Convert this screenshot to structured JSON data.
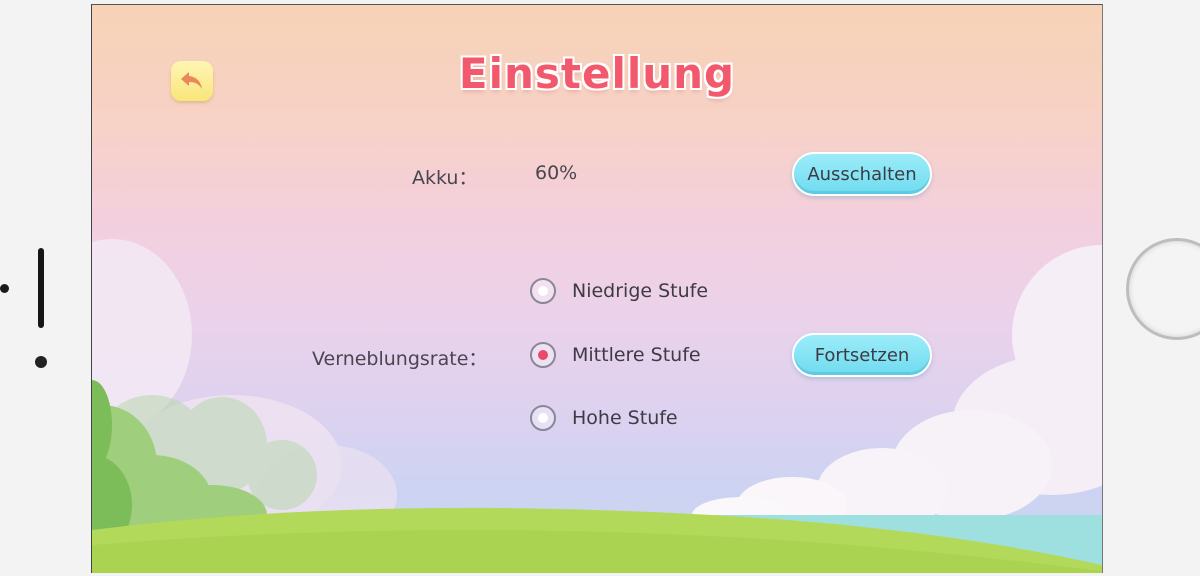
{
  "screen": {
    "title": "Einstellung",
    "back_icon": "back-arrow-icon"
  },
  "battery": {
    "label": "Akku：",
    "value": "60%",
    "shutdown_label": "Ausschalten"
  },
  "glare": {
    "label": "Verneblungsrate：",
    "options": [
      {
        "label": "Niedrige Stufe",
        "selected": false
      },
      {
        "label": "Mittlere Stufe",
        "selected": true
      },
      {
        "label": "Hohe Stufe",
        "selected": false
      }
    ],
    "continue_label": "Fortsetzen"
  },
  "colors": {
    "title": "#f2596d",
    "button": "#6fdcef",
    "radio_selected": "#e84a6c",
    "back_button": "#f9e57a"
  }
}
